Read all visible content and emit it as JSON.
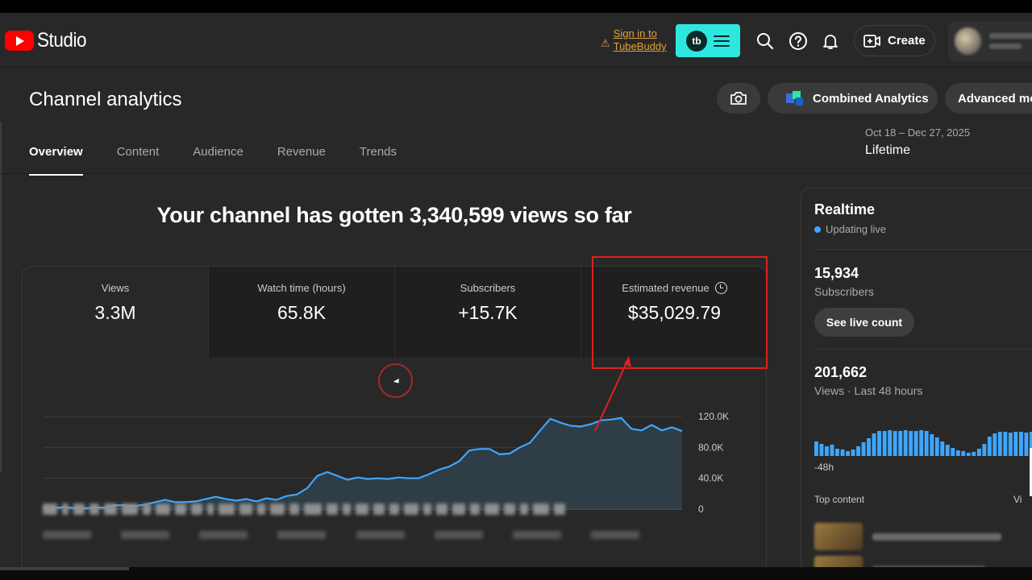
{
  "header": {
    "studio_label": "Studio",
    "tubebuddy_signin": "Sign in to TubeBuddy",
    "tubebuddy_logo": "tb",
    "create_label": "Create"
  },
  "page": {
    "title": "Channel analytics",
    "combined_label": "Combined Analytics",
    "advanced_label": "Advanced mode",
    "date_range": "Oct 18 – Dec 27, 2025",
    "date_label": "Lifetime",
    "tabs": [
      "Overview",
      "Content",
      "Audience",
      "Revenue",
      "Trends"
    ],
    "headline": "Your channel has gotten 3,340,599 views so far"
  },
  "metrics": [
    {
      "label": "Views",
      "value": "3.3M"
    },
    {
      "label": "Watch time (hours)",
      "value": "65.8K"
    },
    {
      "label": "Subscribers",
      "value": "+15.7K"
    },
    {
      "label": "Estimated revenue",
      "value": "$35,029.79"
    }
  ],
  "chart_data": {
    "type": "area",
    "title": "",
    "xlabel": "",
    "ylabel": "",
    "ylim": [
      0,
      120000
    ],
    "y_ticks": [
      "0",
      "40.0K",
      "80.0K",
      "120.0K"
    ],
    "series": [
      {
        "values": [
          1000,
          1500,
          2500,
          1500,
          1000,
          2000,
          2000,
          5000,
          5000,
          4000,
          6000,
          9000,
          12000,
          9000,
          9000,
          10000,
          13000,
          16000,
          13000,
          11000,
          13000,
          10000,
          14000,
          12000,
          17000,
          19000,
          27000,
          43000,
          48000,
          43000,
          38000,
          41000,
          39000,
          40000,
          39000,
          41000,
          40000,
          40000,
          45000,
          51000,
          55000,
          62000,
          76000,
          78000,
          78000,
          71000,
          72000,
          80000,
          86000,
          102000,
          117000,
          112000,
          108000,
          107000,
          110000,
          115000,
          116000,
          118000,
          104000,
          102000,
          109000,
          102000,
          106000,
          101000
        ]
      }
    ]
  },
  "realtime": {
    "title": "Realtime",
    "status": "Updating live",
    "subscribers_value": "15,934",
    "subscribers_label": "Subscribers",
    "live_button": "See live count",
    "views_value": "201,662",
    "views_label": "Views · Last 48 hours",
    "axis_start": "-48h",
    "top_content_label": "Top content",
    "views_col_label": "Vi",
    "bars": [
      18,
      15,
      12,
      14,
      9,
      8,
      6,
      8,
      12,
      17,
      22,
      28,
      31,
      31,
      32,
      31,
      31,
      32,
      31,
      31,
      32,
      31,
      27,
      23,
      18,
      14,
      10,
      7,
      6,
      4,
      5,
      9,
      15,
      24,
      28,
      30,
      30,
      29,
      30,
      30,
      29,
      30,
      30
    ]
  },
  "colors": {
    "accent_cyan": "#2ee8e0",
    "youtube_red": "#ff0000",
    "chart_line": "#3ea6ff",
    "highlight_red": "#e02020"
  }
}
